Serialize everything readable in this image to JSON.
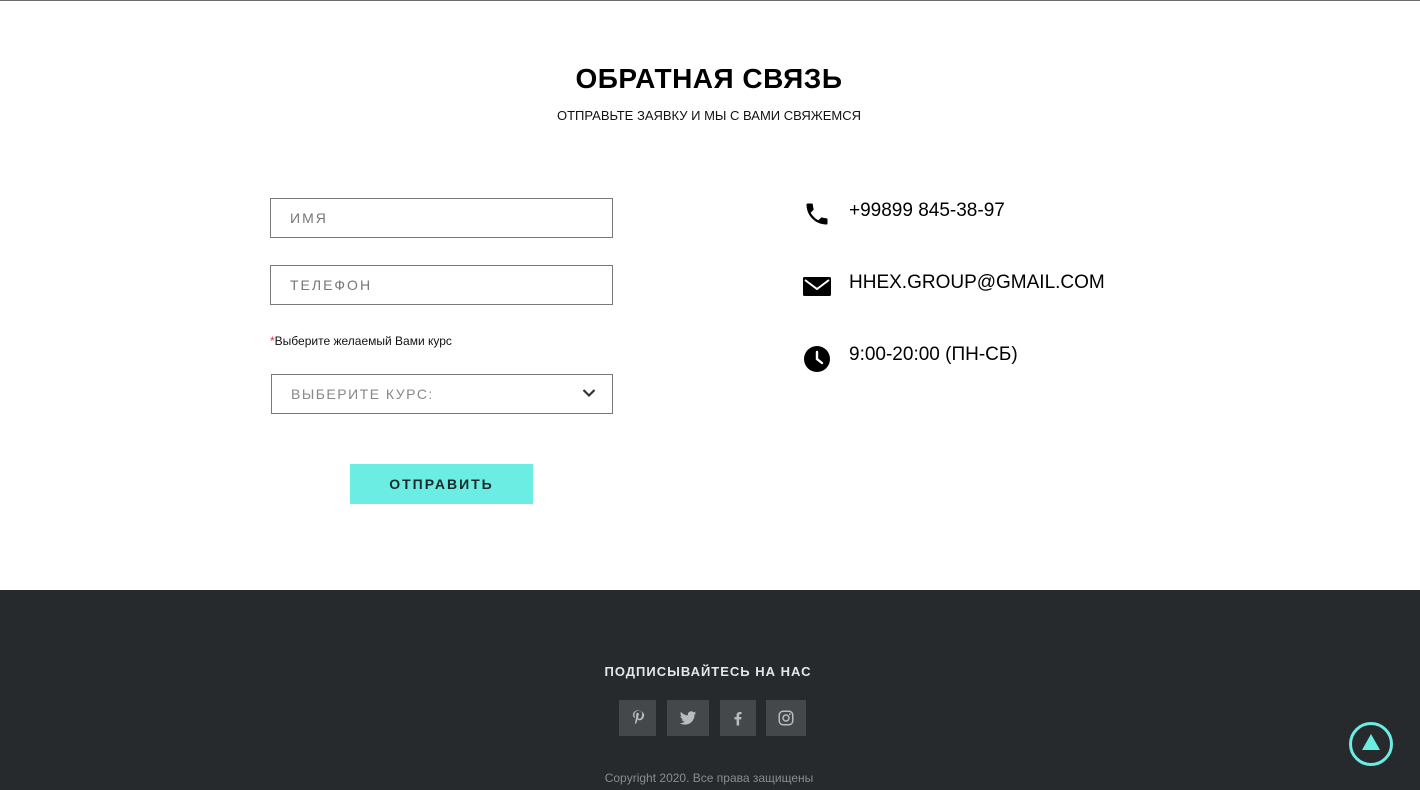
{
  "feedback": {
    "title": "ОБРАТНАЯ СВЯЗЬ",
    "subtitle": "ОТПРАВЬТЕ ЗАЯВКУ И МЫ С ВАМИ СВЯЖЕМСЯ",
    "form": {
      "name_placeholder": "ИМЯ",
      "phone_placeholder": "ТЕЛЕФОН",
      "course_label_required": "*",
      "course_label": "Выберите желаемый Вами курс",
      "course_select_value": "ВЫБЕРИТЕ КУРС:",
      "submit_label": "ОТПРАВИТЬ"
    },
    "contacts": {
      "phone": "+99899 845-38-97",
      "email": "HHEX.GROUP@GMAIL.COM",
      "hours": "9:00-20:00 (ПН-СБ)",
      "icons": [
        "phone-icon",
        "envelope-icon",
        "clock-icon"
      ]
    }
  },
  "footer": {
    "follow_title": "ПОДПИСЫВАЙТЕСЬ НА НАС",
    "socials": [
      "pinterest-icon",
      "twitter-icon",
      "facebook-icon",
      "instagram-icon"
    ],
    "copyright": "Copyright 2020. Все права защищены"
  },
  "colors": {
    "accent": "#6bede4",
    "footer_bg": "#262a2d",
    "social_tile_bg": "#45484b",
    "required_mark": "#e0304a"
  }
}
